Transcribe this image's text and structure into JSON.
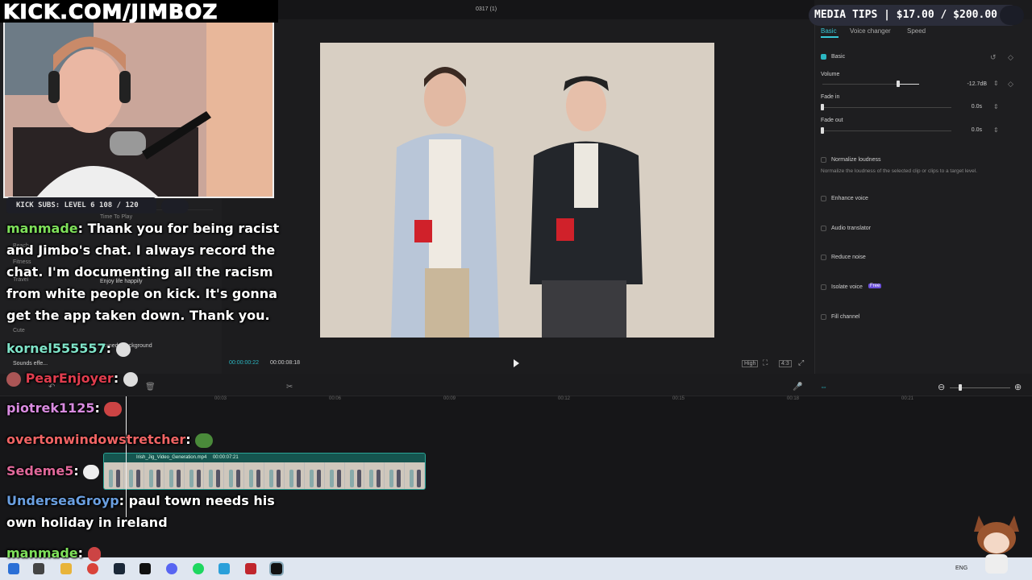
{
  "editor": {
    "window_title": "0317 (1)",
    "right_tabs": [
      "Basic",
      "Voice changer",
      "Speed"
    ],
    "basic_section": "Basic",
    "volume_label": "Volume",
    "volume_value": "-12.7dB",
    "fade_in_label": "Fade in",
    "fade_in_value": "0.0s",
    "fade_out_label": "Fade out",
    "fade_out_value": "0.0s",
    "normalize_label": "Normalize loudness",
    "normalize_desc": "Normalize the loudness of the selected clip or clips to a target level.",
    "enhance_label": "Enhance voice",
    "translator_label": "Audio translator",
    "reduce_label": "Reduce noise",
    "isolate_label": "Isolate voice",
    "isolate_badge": "Free",
    "fill_label": "Fill channel",
    "timecode_current": "00:00:00:22",
    "timecode_total": "00:00:08:18",
    "quality_label": "High",
    "ratio_label": "4:3",
    "ruler_ticks": [
      "00:03",
      "00:06",
      "00:09",
      "00:12",
      "00:15",
      "00:18",
      "00:21"
    ],
    "clip_name": "Irish_Jig_Video_Generation.mp4",
    "clip_duration": "00:00:07:21",
    "left_items": [
      "Time To Play",
      "Beach",
      "Fitness",
      "Travel",
      "Cute",
      "Sounds effe..."
    ],
    "left_tracks": [
      "Enjoy life happily",
      "Comedy background"
    ],
    "taskbar_lang": "ENG"
  },
  "overlay": {
    "channel_banner": "KICK.COM/JIMBOZ",
    "media_tips": "MEDIA TIPS | $17.00 / $200.00",
    "kick_subs": "KICK SUBS: LEVEL 6 108 / 120"
  },
  "chat": [
    {
      "user": "manmade",
      "color": "#7ee05a",
      "text": ": Thank you for being racist"
    },
    {
      "user": "",
      "color": "#fff",
      "text": "and Jimbo's chat. I always record the"
    },
    {
      "user": "",
      "color": "#fff",
      "text": "chat. I'm documenting all the racism"
    },
    {
      "user": "",
      "color": "#fff",
      "text": "from white people on kick. It's gonna"
    },
    {
      "user": "",
      "color": "#fff",
      "text": "get the app taken down. Thank you."
    },
    {
      "user": "kornel555557",
      "color": "#7fe3c8",
      "text": ":"
    },
    {
      "user": "PearEnjoyer",
      "color": "#e03d4e",
      "text": ":"
    },
    {
      "user": "piotrek1125",
      "color": "#d98be0",
      "text": ":"
    },
    {
      "user": "overtonwindowstretcher",
      "color": "#f06464",
      "text": ":"
    },
    {
      "user": "Sedeme5",
      "color": "#e0689a",
      "text": ":"
    },
    {
      "user": "UnderseaGroyp",
      "color": "#6a9fe0",
      "text": ": paul town needs his"
    },
    {
      "user": "",
      "color": "#fff",
      "text": "own holiday in ireland"
    },
    {
      "user": "manmade",
      "color": "#7ee05a",
      "text": ":"
    }
  ],
  "icons": {
    "play": "play-icon",
    "settings": "gear-icon",
    "mic": "microphone-icon"
  }
}
